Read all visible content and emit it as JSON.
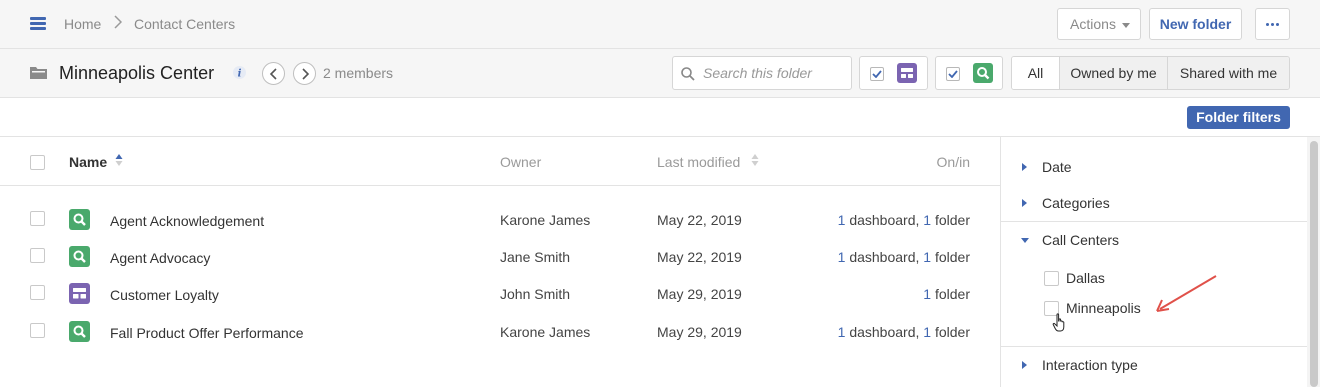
{
  "breadcrumb": {
    "home": "Home",
    "current": "Contact Centers"
  },
  "toolbar": {
    "actions_label": "Actions",
    "new_folder_label": "New folder"
  },
  "folder": {
    "title": "Minneapolis Center",
    "members": "2 members"
  },
  "search": {
    "placeholder": "Search this folder"
  },
  "scope_tabs": {
    "all": "All",
    "owned": "Owned by me",
    "shared": "Shared with me"
  },
  "filters_button": "Folder filters",
  "table": {
    "headers": {
      "name": "Name",
      "owner": "Owner",
      "modified": "Last modified",
      "onin": "On/in"
    },
    "rows": [
      {
        "type": "look",
        "name": "Agent Acknowledgement",
        "owner": "Karone James",
        "modified": "May 22, 2019",
        "dash_count": "1",
        "dash_label": "dashboard,",
        "folder_count": "1",
        "folder_label": "folder"
      },
      {
        "type": "look",
        "name": "Agent Advocacy",
        "owner": "Jane Smith",
        "modified": "May 22, 2019",
        "dash_count": "1",
        "dash_label": "dashboard,",
        "folder_count": "1",
        "folder_label": "folder"
      },
      {
        "type": "dashboard",
        "name": "Customer Loyalty",
        "owner": "John Smith",
        "modified": "May 29, 2019",
        "dash_count": "",
        "dash_label": "",
        "folder_count": "1",
        "folder_label": "folder"
      },
      {
        "type": "look",
        "name": "Fall Product Offer Performance",
        "owner": "Karone James",
        "modified": "May 29, 2019",
        "dash_count": "1",
        "dash_label": "dashboard,",
        "folder_count": "1",
        "folder_label": "folder"
      }
    ]
  },
  "filter_panel": {
    "sections": [
      {
        "label": "Date",
        "expanded": false
      },
      {
        "label": "Categories",
        "expanded": false
      },
      {
        "label": "Call Centers",
        "expanded": true,
        "options": [
          "Dallas",
          "Minneapolis"
        ]
      },
      {
        "label": "Interaction type",
        "expanded": false
      }
    ]
  },
  "colors": {
    "accent": "#4167b1",
    "look_icon": "#4aa96c",
    "dashboard_icon": "#7b64b1",
    "annotation_arrow": "#e0514a"
  },
  "icons": [
    "hamburger-icon",
    "folder-icon",
    "info-icon",
    "chevron-left-icon",
    "chevron-right-icon",
    "search-icon",
    "dashboard-icon",
    "look-icon",
    "sort-icon",
    "caret-right-icon",
    "caret-down-icon",
    "hand-cursor-icon"
  ]
}
